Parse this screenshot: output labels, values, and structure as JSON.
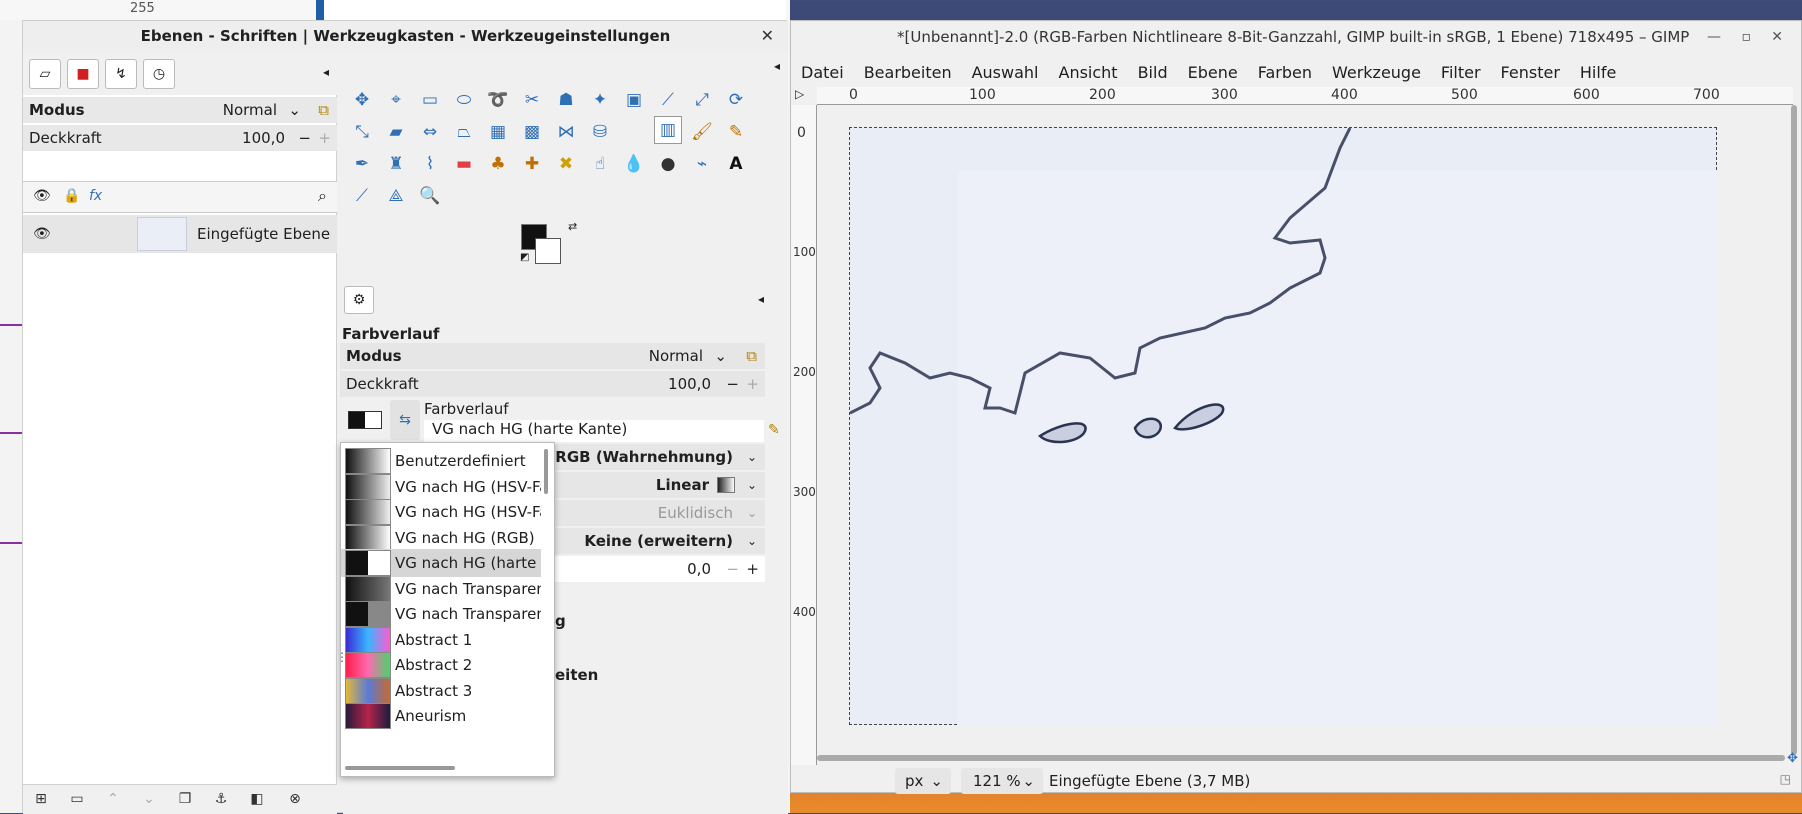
{
  "background_app": {
    "field_value": "255"
  },
  "dock": {
    "title": "Ebenen - Schriften | Werkzeugkasten - Werkzeugeinstellungen",
    "layers": {
      "mode_label": "Modus",
      "mode_value": "Normal",
      "opacity_label": "Deckkraft",
      "opacity_value": "100,0",
      "layer_name": "Eingefügte Ebene"
    },
    "tool_options": {
      "title": "Farbverlauf",
      "mode_label": "Modus",
      "mode_value": "Normal",
      "opacity_label": "Deckkraft",
      "opacity_value": "100,0",
      "gradient_label": "Farbverlauf",
      "gradient_value": "VG nach HG (harte Kante)",
      "blend_color_space": "RGB (Wahrnehmung)",
      "shape": "Linear",
      "metric": "Euklidisch",
      "repeat": "Keine (erweitern)",
      "offset": "0,0",
      "partial_text_1": "g",
      "partial_text_2": "eiten"
    },
    "gradient_list": [
      {
        "name": "Benutzerdefiniert",
        "style": "linear-gradient(90deg,#111,#fff)"
      },
      {
        "name": "VG nach HG (HSV-Farb",
        "style": "linear-gradient(90deg,#111,#eee)"
      },
      {
        "name": "VG nach HG (HSV-Farb",
        "style": "linear-gradient(90deg,#111,#eee)"
      },
      {
        "name": "VG nach HG (RGB)",
        "style": "linear-gradient(90deg,#111,#fff)"
      },
      {
        "name": "VG nach HG (harte Ka",
        "style": "linear-gradient(90deg,#111 50%,#fff 50%)"
      },
      {
        "name": "VG nach Transparent",
        "style": "linear-gradient(90deg,#111,#777)"
      },
      {
        "name": "VG nach Transparent",
        "style": "linear-gradient(90deg,#111 50%,#888 50%)"
      },
      {
        "name": "Abstract 1",
        "style": "linear-gradient(90deg,#3b2bd6,#3ab5ff,#ff5ad0)"
      },
      {
        "name": "Abstract 2",
        "style": "linear-gradient(90deg,#ff1f4b,#ff6ab0,#47d46b)"
      },
      {
        "name": "Abstract 3",
        "style": "linear-gradient(90deg,#e2b83a,#5a7ad8,#c86a2a)"
      },
      {
        "name": "Aneurism",
        "style": "linear-gradient(90deg,#2a1b3b,#b5244a,#1c1c40)"
      }
    ]
  },
  "image_window": {
    "title": "*[Unbenannt]-2.0 (RGB-Farben Nichtlineare 8-Bit-Ganzzahl, GIMP built-in sRGB, 1 Ebene) 718x495 – GIMP",
    "menus": [
      "Datei",
      "Bearbeiten",
      "Auswahl",
      "Ansicht",
      "Bild",
      "Ebene",
      "Farben",
      "Werkzeuge",
      "Filter",
      "Fenster",
      "Hilfe"
    ],
    "ruler_h_labels": [
      "0",
      "100",
      "200",
      "300",
      "400",
      "500",
      "600",
      "700"
    ],
    "ruler_v_labels": [
      "0",
      "100",
      "200",
      "300",
      "400"
    ],
    "unit": "px",
    "zoom": "121 %",
    "status": "Eingefügte Ebene (3,7 MB)"
  }
}
